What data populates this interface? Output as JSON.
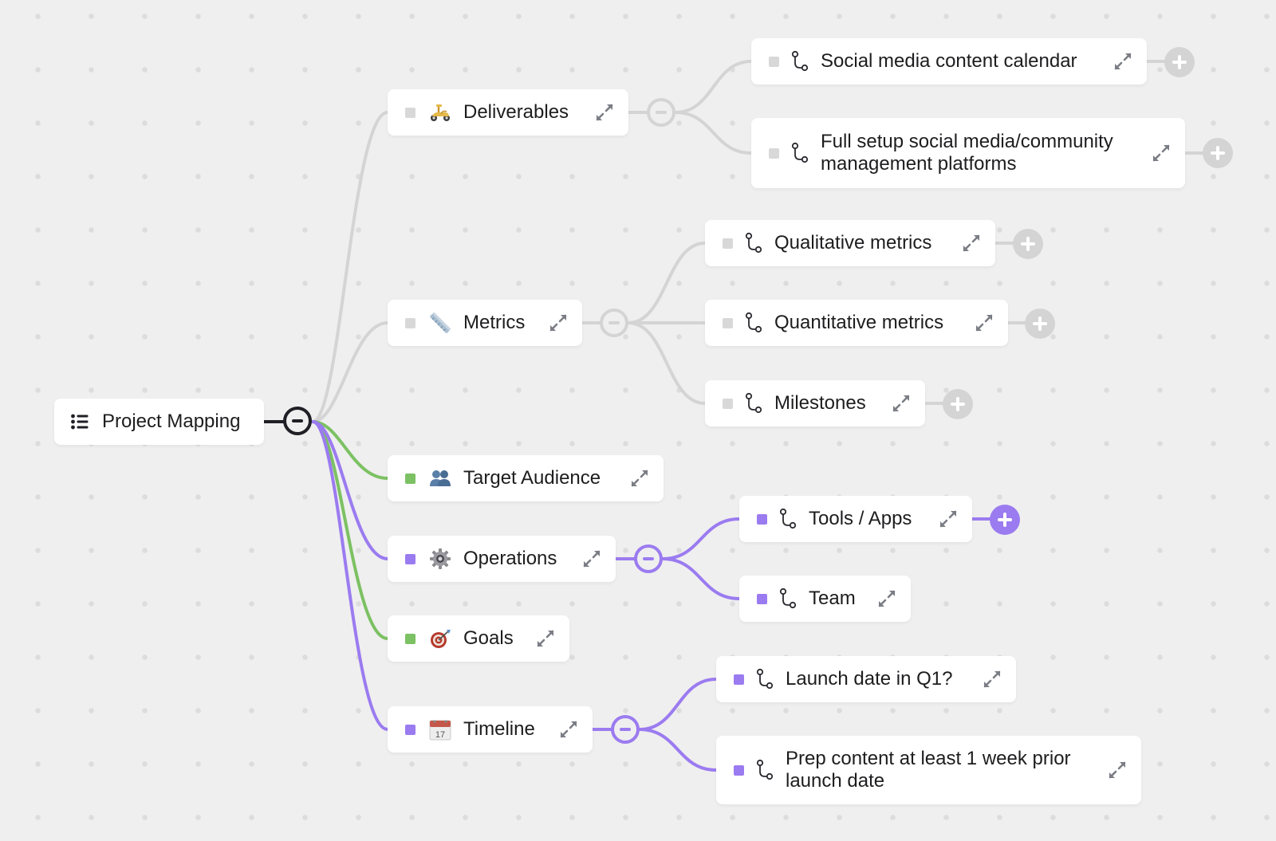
{
  "colors": {
    "background": "#efefef",
    "grey_branch": "#d4d4d4",
    "grey_square": "#d8d8d8",
    "green": "#7cc163",
    "purple": "#9b7bf0",
    "root_dark": "#1f1f25",
    "expand_icon": "#7b7d85"
  },
  "root": {
    "label": "Project Mapping",
    "icon": "list-bullets-icon",
    "toggle": "collapse"
  },
  "branches": [
    {
      "id": "deliverables",
      "label": "Deliverables",
      "icon": "motor-scooter-emoji",
      "emoji": "🛵",
      "color": "grey",
      "toggle": "collapse",
      "children": [
        {
          "label": "Social media content calendar",
          "icon": "branch-icon",
          "action": "add"
        },
        {
          "label": "Full setup social media/community management platforms",
          "icon": "branch-icon",
          "action": "add"
        }
      ]
    },
    {
      "id": "metrics",
      "label": "Metrics",
      "icon": "ruler-emoji",
      "emoji": "📏",
      "color": "grey",
      "toggle": "collapse",
      "children": [
        {
          "label": "Qualitative metrics",
          "icon": "branch-icon",
          "action": "add"
        },
        {
          "label": "Quantitative metrics",
          "icon": "branch-icon",
          "action": "add"
        },
        {
          "label": "Milestones",
          "icon": "branch-icon",
          "action": "add"
        }
      ]
    },
    {
      "id": "target-audience",
      "label": "Target Audience",
      "icon": "people-emoji",
      "emoji": "👥",
      "color": "green",
      "children": []
    },
    {
      "id": "operations",
      "label": "Operations",
      "icon": "gear-emoji",
      "emoji": "⚙️",
      "color": "purple",
      "toggle": "collapse",
      "children": [
        {
          "label": "Tools / Apps",
          "icon": "branch-icon",
          "action": "add"
        },
        {
          "label": "Team",
          "icon": "branch-icon"
        }
      ]
    },
    {
      "id": "goals",
      "label": "Goals",
      "icon": "target-emoji",
      "emoji": "🎯",
      "color": "green",
      "children": []
    },
    {
      "id": "timeline",
      "label": "Timeline",
      "icon": "calendar-emoji",
      "emoji": "📅",
      "color": "purple",
      "toggle": "collapse",
      "children": [
        {
          "label": "Launch date in Q1?",
          "icon": "branch-icon"
        },
        {
          "label": "Prep content at least 1 week prior launch date",
          "icon": "branch-icon"
        }
      ]
    }
  ]
}
